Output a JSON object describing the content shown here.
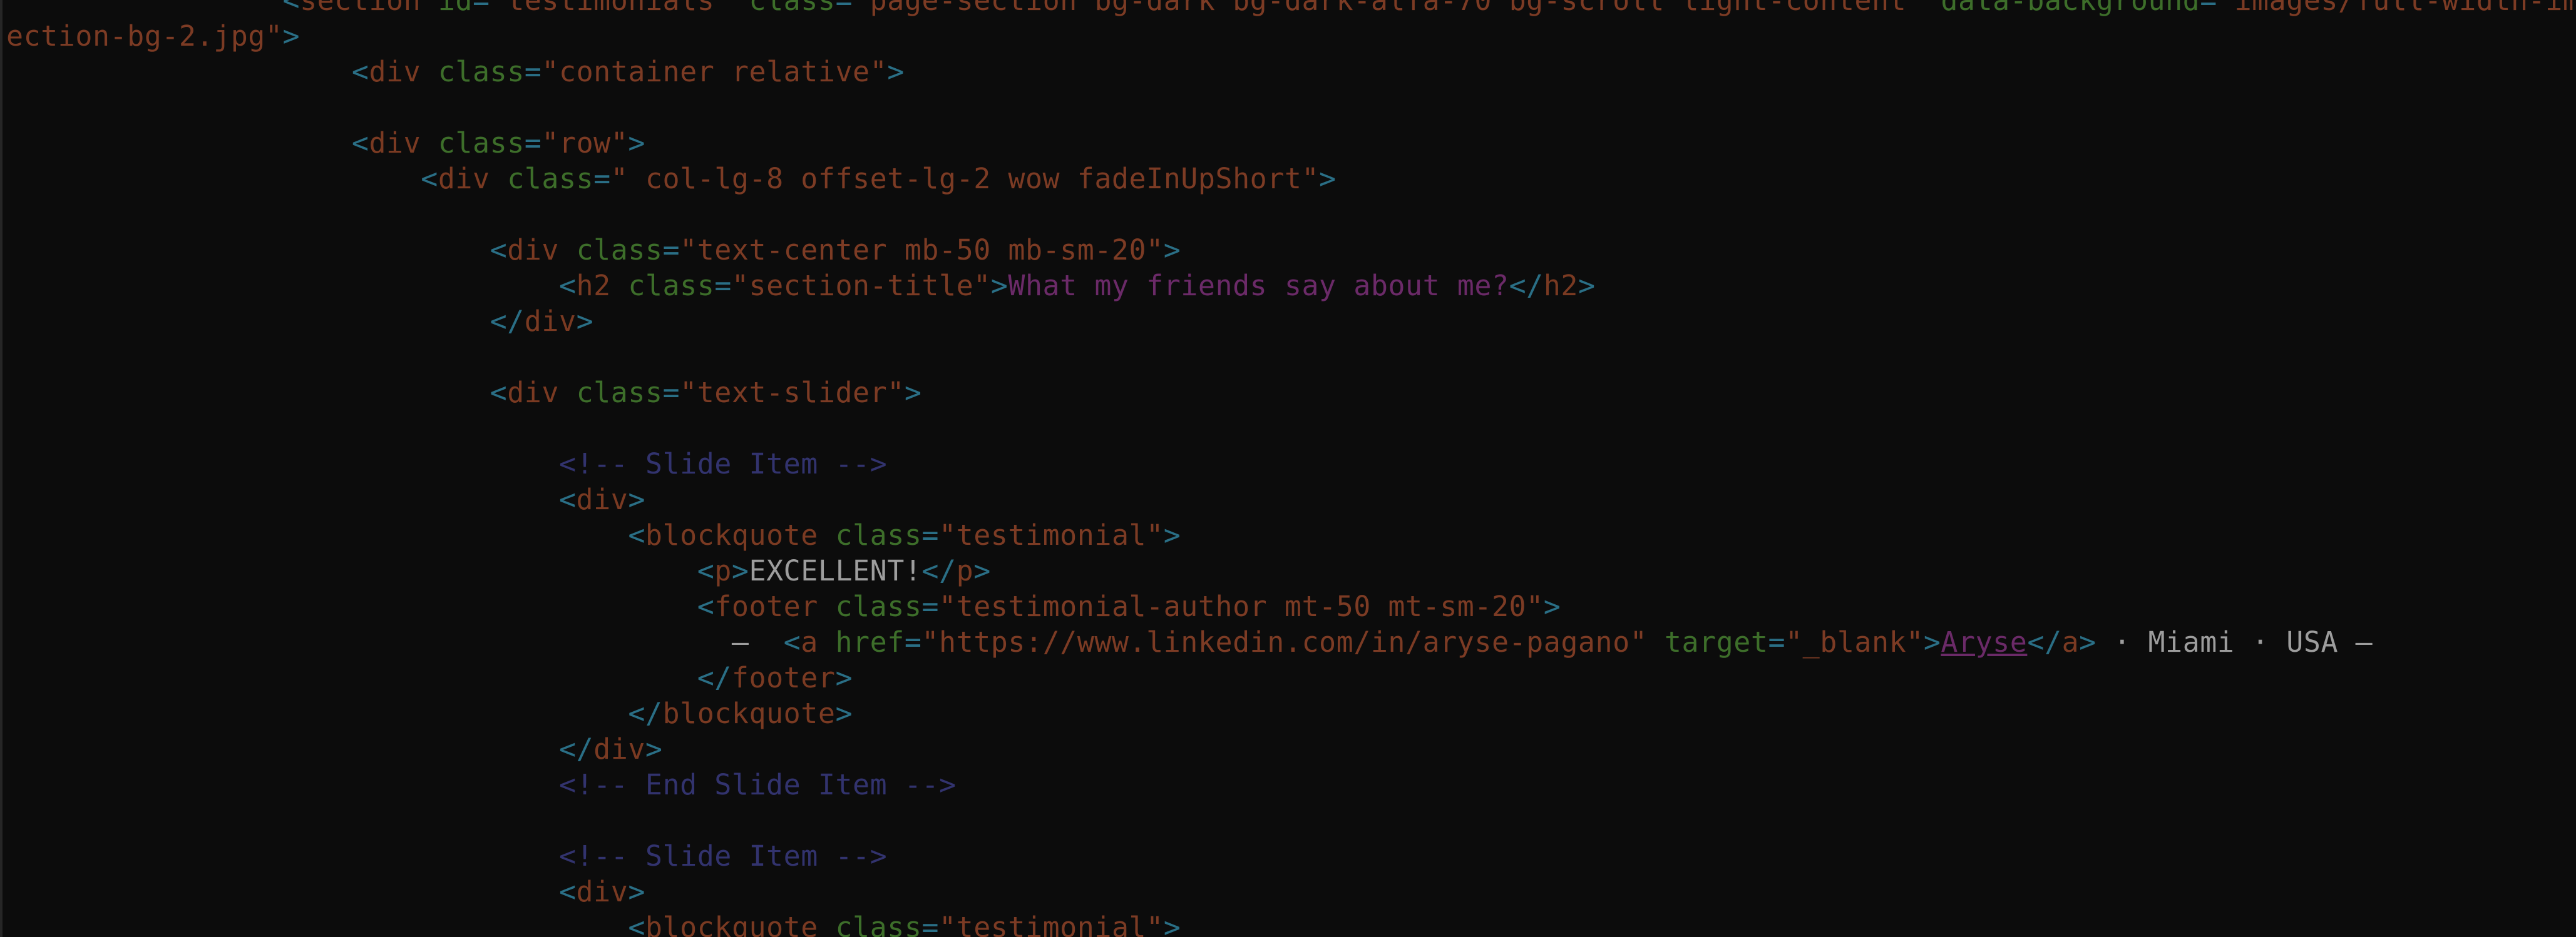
{
  "editor": {
    "theme_colors": {
      "background": "#0c0c0c",
      "punctuation": "#2a6f86",
      "tag_name": "#7a3a22",
      "attribute": "#3d6e2a",
      "value": "#7c3b24",
      "text": "#9d9d9d",
      "title_text": "#6b2a68",
      "comment": "#32336e"
    }
  },
  "lines": [
    {
      "indent": 8,
      "tokens": [
        {
          "t": "ptag",
          "v": "<"
        },
        {
          "t": "tname",
          "v": "section"
        },
        {
          "t": "plain",
          "v": " "
        },
        {
          "t": "attr",
          "v": "id"
        },
        {
          "t": "eq",
          "v": "="
        },
        {
          "t": "val",
          "v": "\"testimonials\""
        },
        {
          "t": "plain",
          "v": " "
        },
        {
          "t": "attr",
          "v": "class"
        },
        {
          "t": "eq",
          "v": "="
        },
        {
          "t": "val",
          "v": "\"page-section bg-dark bg-dark-alfa-70 bg-scroll light-content\""
        },
        {
          "t": "plain",
          "v": " "
        },
        {
          "t": "attr",
          "v": "data-background"
        },
        {
          "t": "eq",
          "v": "="
        },
        {
          "t": "val",
          "v": "\"images/full-width-image"
        }
      ]
    },
    {
      "indent": 0,
      "tokens": [
        {
          "t": "val",
          "v": "ection-bg-2.jpg\""
        },
        {
          "t": "ptag",
          "v": ">"
        }
      ]
    },
    {
      "indent": 10,
      "tokens": [
        {
          "t": "ptag",
          "v": "<"
        },
        {
          "t": "tname",
          "v": "div"
        },
        {
          "t": "plain",
          "v": " "
        },
        {
          "t": "attr",
          "v": "class"
        },
        {
          "t": "eq",
          "v": "="
        },
        {
          "t": "val",
          "v": "\"container relative\""
        },
        {
          "t": "ptag",
          "v": ">"
        }
      ]
    },
    {
      "indent": 0,
      "tokens": []
    },
    {
      "indent": 10,
      "tokens": [
        {
          "t": "ptag",
          "v": "<"
        },
        {
          "t": "tname",
          "v": "div"
        },
        {
          "t": "plain",
          "v": " "
        },
        {
          "t": "attr",
          "v": "class"
        },
        {
          "t": "eq",
          "v": "="
        },
        {
          "t": "val",
          "v": "\"row\""
        },
        {
          "t": "ptag",
          "v": ">"
        }
      ]
    },
    {
      "indent": 12,
      "tokens": [
        {
          "t": "ptag",
          "v": "<"
        },
        {
          "t": "tname",
          "v": "div"
        },
        {
          "t": "plain",
          "v": " "
        },
        {
          "t": "attr",
          "v": "class"
        },
        {
          "t": "eq",
          "v": "="
        },
        {
          "t": "val",
          "v": "\" col-lg-8 offset-lg-2 wow fadeInUpShort\""
        },
        {
          "t": "ptag",
          "v": ">"
        }
      ]
    },
    {
      "indent": 0,
      "tokens": []
    },
    {
      "indent": 14,
      "tokens": [
        {
          "t": "ptag",
          "v": "<"
        },
        {
          "t": "tname",
          "v": "div"
        },
        {
          "t": "plain",
          "v": " "
        },
        {
          "t": "attr",
          "v": "class"
        },
        {
          "t": "eq",
          "v": "="
        },
        {
          "t": "val",
          "v": "\"text-center mb-50 mb-sm-20\""
        },
        {
          "t": "ptag",
          "v": ">"
        }
      ]
    },
    {
      "indent": 16,
      "tokens": [
        {
          "t": "ptag",
          "v": "<"
        },
        {
          "t": "tname",
          "v": "h2"
        },
        {
          "t": "plain",
          "v": " "
        },
        {
          "t": "attr",
          "v": "class"
        },
        {
          "t": "eq",
          "v": "="
        },
        {
          "t": "val",
          "v": "\"section-title\""
        },
        {
          "t": "ptag",
          "v": ">"
        },
        {
          "t": "purple",
          "v": "What my friends say about me?"
        },
        {
          "t": "ptag",
          "v": "</"
        },
        {
          "t": "tname",
          "v": "h2"
        },
        {
          "t": "ptag",
          "v": ">"
        }
      ]
    },
    {
      "indent": 14,
      "tokens": [
        {
          "t": "ptag",
          "v": "</"
        },
        {
          "t": "tname",
          "v": "div"
        },
        {
          "t": "ptag",
          "v": ">"
        }
      ]
    },
    {
      "indent": 0,
      "tokens": []
    },
    {
      "indent": 14,
      "tokens": [
        {
          "t": "ptag",
          "v": "<"
        },
        {
          "t": "tname",
          "v": "div"
        },
        {
          "t": "plain",
          "v": " "
        },
        {
          "t": "attr",
          "v": "class"
        },
        {
          "t": "eq",
          "v": "="
        },
        {
          "t": "val",
          "v": "\"text-slider\""
        },
        {
          "t": "ptag",
          "v": ">"
        }
      ]
    },
    {
      "indent": 0,
      "tokens": []
    },
    {
      "indent": 16,
      "tokens": [
        {
          "t": "cmt",
          "v": "<!-- Slide Item -->"
        }
      ]
    },
    {
      "indent": 16,
      "tokens": [
        {
          "t": "ptag",
          "v": "<"
        },
        {
          "t": "tname",
          "v": "div"
        },
        {
          "t": "ptag",
          "v": ">"
        }
      ]
    },
    {
      "indent": 18,
      "tokens": [
        {
          "t": "ptag",
          "v": "<"
        },
        {
          "t": "tname",
          "v": "blockquote"
        },
        {
          "t": "plain",
          "v": " "
        },
        {
          "t": "attr",
          "v": "class"
        },
        {
          "t": "eq",
          "v": "="
        },
        {
          "t": "val",
          "v": "\"testimonial\""
        },
        {
          "t": "ptag",
          "v": ">"
        }
      ]
    },
    {
      "indent": 20,
      "tokens": [
        {
          "t": "ptag",
          "v": "<"
        },
        {
          "t": "tname",
          "v": "p"
        },
        {
          "t": "ptag",
          "v": ">"
        },
        {
          "t": "txt",
          "v": "EXCELLENT!"
        },
        {
          "t": "ptag",
          "v": "</"
        },
        {
          "t": "tname",
          "v": "p"
        },
        {
          "t": "ptag",
          "v": ">"
        }
      ]
    },
    {
      "indent": 20,
      "tokens": [
        {
          "t": "ptag",
          "v": "<"
        },
        {
          "t": "tname",
          "v": "footer"
        },
        {
          "t": "plain",
          "v": " "
        },
        {
          "t": "attr",
          "v": "class"
        },
        {
          "t": "eq",
          "v": "="
        },
        {
          "t": "val",
          "v": "\"testimonial-author mt-50 mt-sm-20\""
        },
        {
          "t": "ptag",
          "v": ">"
        }
      ]
    },
    {
      "indent": 21,
      "tokens": [
        {
          "t": "txt",
          "v": "—  "
        },
        {
          "t": "ptag",
          "v": "<"
        },
        {
          "t": "tname",
          "v": "a"
        },
        {
          "t": "plain",
          "v": " "
        },
        {
          "t": "attr",
          "v": "href"
        },
        {
          "t": "eq",
          "v": "="
        },
        {
          "t": "val",
          "v": "\"https://www.linkedin.com/in/aryse-pagano\""
        },
        {
          "t": "plain",
          "v": " "
        },
        {
          "t": "attr",
          "v": "target"
        },
        {
          "t": "eq",
          "v": "="
        },
        {
          "t": "val",
          "v": "\"_blank\""
        },
        {
          "t": "ptag",
          "v": ">"
        },
        {
          "t": "link",
          "v": "Aryse"
        },
        {
          "t": "ptag",
          "v": "</"
        },
        {
          "t": "tname",
          "v": "a"
        },
        {
          "t": "ptag",
          "v": ">"
        },
        {
          "t": "txt",
          "v": " · Miami · USA —"
        }
      ]
    },
    {
      "indent": 20,
      "tokens": [
        {
          "t": "ptag",
          "v": "</"
        },
        {
          "t": "tname",
          "v": "footer"
        },
        {
          "t": "ptag",
          "v": ">"
        }
      ]
    },
    {
      "indent": 18,
      "tokens": [
        {
          "t": "ptag",
          "v": "</"
        },
        {
          "t": "tname",
          "v": "blockquote"
        },
        {
          "t": "ptag",
          "v": ">"
        }
      ]
    },
    {
      "indent": 16,
      "tokens": [
        {
          "t": "ptag",
          "v": "</"
        },
        {
          "t": "tname",
          "v": "div"
        },
        {
          "t": "ptag",
          "v": ">"
        }
      ]
    },
    {
      "indent": 16,
      "tokens": [
        {
          "t": "cmt",
          "v": "<!-- End Slide Item -->"
        }
      ]
    },
    {
      "indent": 0,
      "tokens": []
    },
    {
      "indent": 16,
      "tokens": [
        {
          "t": "cmt",
          "v": "<!-- Slide Item -->"
        }
      ]
    },
    {
      "indent": 16,
      "tokens": [
        {
          "t": "ptag",
          "v": "<"
        },
        {
          "t": "tname",
          "v": "div"
        },
        {
          "t": "ptag",
          "v": ">"
        }
      ]
    },
    {
      "indent": 18,
      "tokens": [
        {
          "t": "ptag",
          "v": "<"
        },
        {
          "t": "tname",
          "v": "blockquote"
        },
        {
          "t": "plain",
          "v": " "
        },
        {
          "t": "attr",
          "v": "class"
        },
        {
          "t": "eq",
          "v": "="
        },
        {
          "t": "val",
          "v": "\"testimonial\""
        },
        {
          "t": "ptag",
          "v": ">"
        }
      ]
    }
  ]
}
